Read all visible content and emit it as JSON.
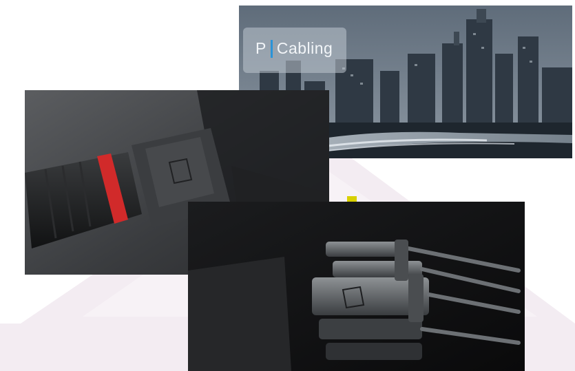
{
  "brand": {
    "logo_letter": "P",
    "logo_word": "Cabling",
    "accent_color": "#2a93d8"
  },
  "photos": [
    {
      "subject": "city-skyline-at-night"
    },
    {
      "subject": "black-connector-with-red-ring"
    },
    {
      "subject": "bundle-of-cable-connectors"
    }
  ],
  "colors": {
    "background_mark": "#f1e9f0",
    "yellow_accent": "#d8d000",
    "red_ring": "#d12a2a"
  }
}
